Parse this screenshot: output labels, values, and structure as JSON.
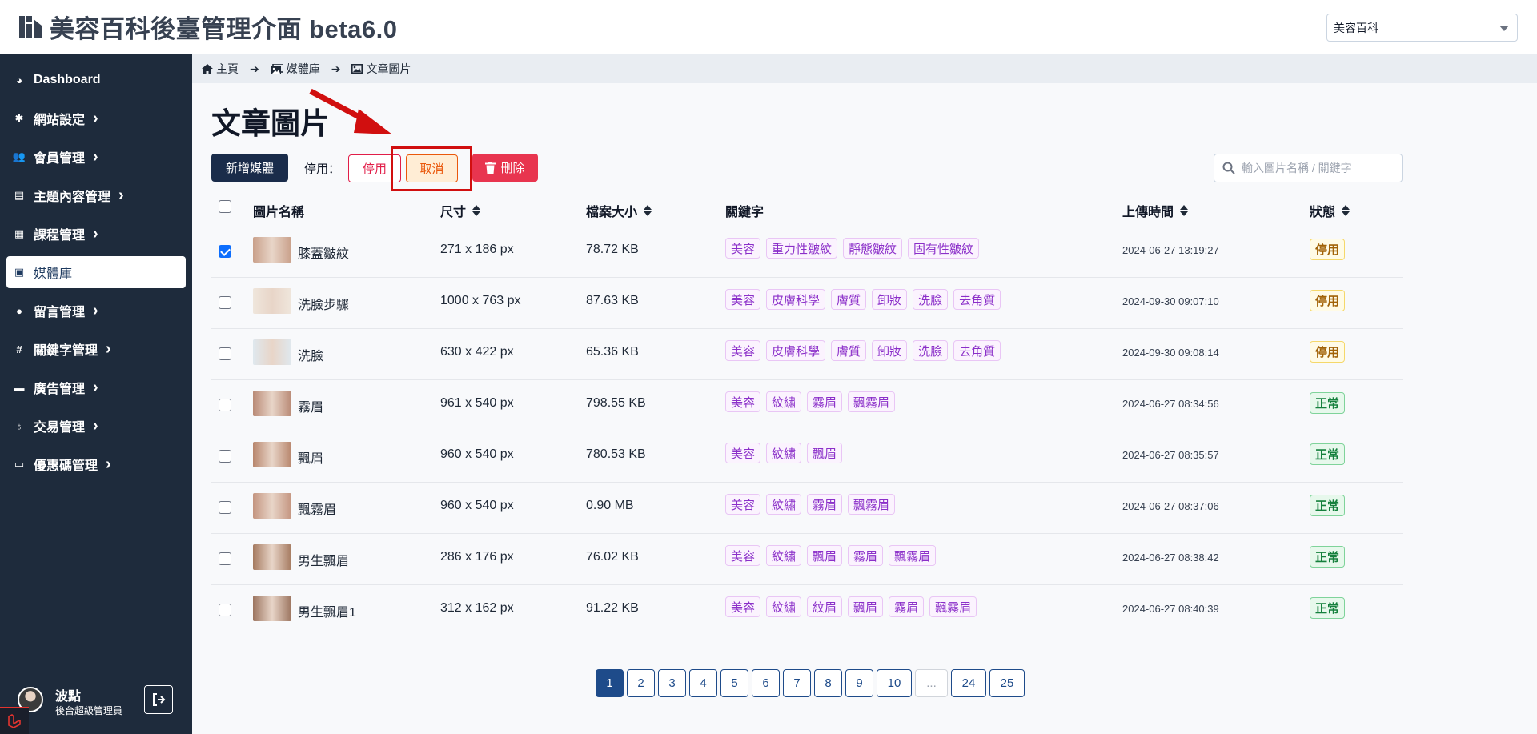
{
  "app": {
    "title": "美容百科後臺管理介面 beta6.0",
    "site_select": "美容百科"
  },
  "sidebar": {
    "items": [
      {
        "label": "Dashboard",
        "icon": "dashboard-icon",
        "chevron": false,
        "active": false
      },
      {
        "label": "網站設定",
        "icon": "gear-icon",
        "chevron": true,
        "active": false
      },
      {
        "label": "會員管理",
        "icon": "users-icon",
        "chevron": true,
        "active": false
      },
      {
        "label": "主題內容管理",
        "icon": "book-icon",
        "chevron": true,
        "active": false
      },
      {
        "label": "課程管理",
        "icon": "book-open-icon",
        "chevron": true,
        "active": false
      },
      {
        "label": "媒體庫",
        "icon": "images-icon",
        "chevron": false,
        "active": true
      },
      {
        "label": "留言管理",
        "icon": "comment-icon",
        "chevron": true,
        "active": false
      },
      {
        "label": "關鍵字管理",
        "icon": "hashtag-icon",
        "chevron": true,
        "active": false
      },
      {
        "label": "廣告管理",
        "icon": "ad-icon",
        "chevron": true,
        "active": false
      },
      {
        "label": "交易管理",
        "icon": "money-bag-icon",
        "chevron": true,
        "active": false
      },
      {
        "label": "優惠碼管理",
        "icon": "ticket-icon",
        "chevron": true,
        "active": false
      }
    ],
    "user": {
      "name": "波點",
      "role": "後台超級管理員"
    }
  },
  "breadcrumb": {
    "home": "主頁",
    "media": "媒體庫",
    "current": "文章圖片"
  },
  "page": {
    "title": "文章圖片"
  },
  "toolbar": {
    "new_label": "新增媒體",
    "stop_prefix": "停用：",
    "stop_label": "停用",
    "cancel_label": "取消",
    "delete_label": "刪除",
    "search_placeholder": "輸入圖片名稱 / 關鍵字"
  },
  "table": {
    "headers": {
      "name": "圖片名稱",
      "size": "尺寸",
      "filesize": "檔案大小",
      "keywords": "關鍵字",
      "uploaded": "上傳時間",
      "status": "狀態"
    },
    "rows": [
      {
        "checked": true,
        "name": "膝蓋皺紋",
        "size": "271 x 186 px",
        "filesize": "78.72 KB",
        "tags": [
          "美容",
          "重力性皺紋",
          "靜態皺紋",
          "固有性皺紋"
        ],
        "uploaded": "2024-06-27 13:19:27",
        "status": "停用",
        "status_type": "stop",
        "thumb": "#c9a08a"
      },
      {
        "checked": false,
        "name": "洗臉步驟",
        "size": "1000 x 763 px",
        "filesize": "87.63 KB",
        "tags": [
          "美容",
          "皮膚科學",
          "膚質",
          "卸妝",
          "洗臉",
          "去角質"
        ],
        "uploaded": "2024-09-30 09:07:10",
        "status": "停用",
        "status_type": "stop",
        "thumb": "#efe6dc"
      },
      {
        "checked": false,
        "name": "洗臉",
        "size": "630 x 422 px",
        "filesize": "65.36 KB",
        "tags": [
          "美容",
          "皮膚科學",
          "膚質",
          "卸妝",
          "洗臉",
          "去角質"
        ],
        "uploaded": "2024-09-30 09:08:14",
        "status": "停用",
        "status_type": "stop",
        "thumb": "#dfe8ee"
      },
      {
        "checked": false,
        "name": "霧眉",
        "size": "961 x 540 px",
        "filesize": "798.55 KB",
        "tags": [
          "美容",
          "紋繡",
          "霧眉",
          "飄霧眉"
        ],
        "uploaded": "2024-06-27 08:34:56",
        "status": "正常",
        "status_type": "ok",
        "thumb": "#b98a76"
      },
      {
        "checked": false,
        "name": "飄眉",
        "size": "960 x 540 px",
        "filesize": "780.53 KB",
        "tags": [
          "美容",
          "紋繡",
          "飄眉"
        ],
        "uploaded": "2024-06-27 08:35:57",
        "status": "正常",
        "status_type": "ok",
        "thumb": "#b8866d"
      },
      {
        "checked": false,
        "name": "飄霧眉",
        "size": "960 x 540 px",
        "filesize": "0.90 MB",
        "tags": [
          "美容",
          "紋繡",
          "霧眉",
          "飄霧眉"
        ],
        "uploaded": "2024-06-27 08:37:06",
        "status": "正常",
        "status_type": "ok",
        "thumb": "#c49580"
      },
      {
        "checked": false,
        "name": "男生飄眉",
        "size": "286 x 176 px",
        "filesize": "76.02 KB",
        "tags": [
          "美容",
          "紋繡",
          "飄眉",
          "霧眉",
          "飄霧眉"
        ],
        "uploaded": "2024-06-27 08:38:42",
        "status": "正常",
        "status_type": "ok",
        "thumb": "#a57a60"
      },
      {
        "checked": false,
        "name": "男生飄眉1",
        "size": "312 x 162 px",
        "filesize": "91.22 KB",
        "tags": [
          "美容",
          "紋繡",
          "紋眉",
          "飄眉",
          "霧眉",
          "飄霧眉"
        ],
        "uploaded": "2024-06-27 08:40:39",
        "status": "正常",
        "status_type": "ok",
        "thumb": "#9c7560"
      }
    ]
  },
  "pagination": {
    "pages": [
      "1",
      "2",
      "3",
      "4",
      "5",
      "6",
      "7",
      "8",
      "9",
      "10",
      "...",
      "24",
      "25"
    ],
    "current": "1"
  },
  "colors": {
    "sidebar_bg": "#1e2b3c",
    "primary": "#1a2c4a",
    "danger": "#e8354f",
    "tag": "#8b2fc9",
    "status_stop": "#a16207",
    "status_ok": "#15803d",
    "annotation": "#d10f0f"
  }
}
